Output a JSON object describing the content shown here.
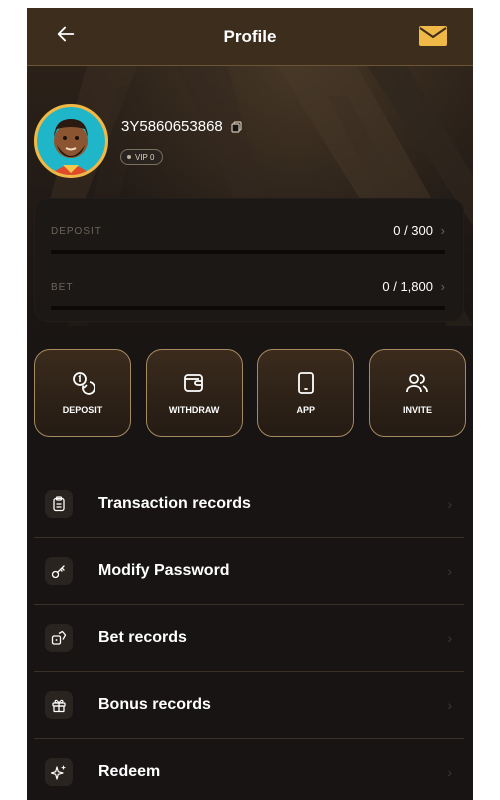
{
  "header": {
    "title": "Profile"
  },
  "user": {
    "id": "3Y5860653868",
    "vip_label": "VIP 0"
  },
  "progress": [
    {
      "key": "deposit",
      "label": "DEPOSIT",
      "value": "0 / 300",
      "fraction": 0
    },
    {
      "key": "bet",
      "label": "BET",
      "value": "0 / 1,800",
      "fraction": 0
    }
  ],
  "actions": [
    {
      "key": "deposit",
      "label": "DEPOSIT",
      "icon": "coins-icon"
    },
    {
      "key": "withdraw",
      "label": "WITHDRAW",
      "icon": "wallet-icon"
    },
    {
      "key": "app",
      "label": "APP",
      "icon": "phone-icon"
    },
    {
      "key": "invite",
      "label": "INVITE",
      "icon": "users-icon"
    }
  ],
  "menu": [
    {
      "key": "transaction",
      "label": "Transaction records",
      "icon": "clipboard-icon"
    },
    {
      "key": "password",
      "label": "Modify Password",
      "icon": "key-icon"
    },
    {
      "key": "bet",
      "label": "Bet records",
      "icon": "dice-icon"
    },
    {
      "key": "bonus",
      "label": "Bonus records",
      "icon": "gift-icon"
    },
    {
      "key": "redeem",
      "label": "Redeem",
      "icon": "sparkles-icon"
    }
  ],
  "colors": {
    "accent": "#f0b846",
    "gold_border": "#a78962",
    "background": "#171413",
    "header": "#3d2d1c"
  }
}
